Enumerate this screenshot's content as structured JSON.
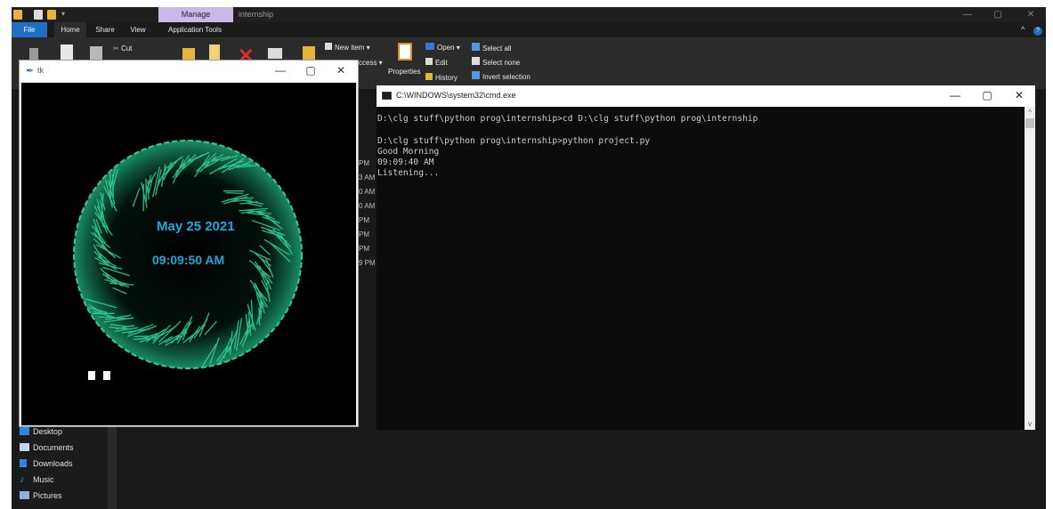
{
  "explorer": {
    "title": "internship",
    "manage_tab": "Manage",
    "tabs": [
      "File",
      "Home",
      "Share",
      "View",
      "Application Tools"
    ],
    "ribbon": {
      "cut": "Cut",
      "new_item": "New item ▾",
      "easy_access": "ccess ▾",
      "properties": "Properties",
      "open": "Open ▾",
      "edit": "Edit",
      "history": "History",
      "select_all": "Select all",
      "select_none": "Select none",
      "invert_selection": "Invert selection"
    },
    "partial_times": [
      "PM",
      "3 AM",
      "0 AM",
      "0 AM",
      "PM",
      "PM",
      "PM",
      "9 PM"
    ],
    "nav_items": [
      "Desktop",
      "Documents",
      "Downloads",
      "Music",
      "Pictures"
    ]
  },
  "tk_window": {
    "title": "tk",
    "date": "May 25 2021",
    "time": "09:09:50 AM"
  },
  "cmd_window": {
    "title": "C:\\WINDOWS\\system32\\cmd.exe",
    "lines": [
      "D:\\clg stuff\\python prog\\internship>cd D:\\clg stuff\\python prog\\internship",
      "",
      "D:\\clg stuff\\python prog\\internship>python project.py",
      "Good Morning",
      "09:09:40 AM",
      "Listening..."
    ]
  },
  "colors": {
    "accent_blue": "#1e6fc5",
    "clock_text": "#1ea7df",
    "orb_green": "#2ecf8f"
  }
}
